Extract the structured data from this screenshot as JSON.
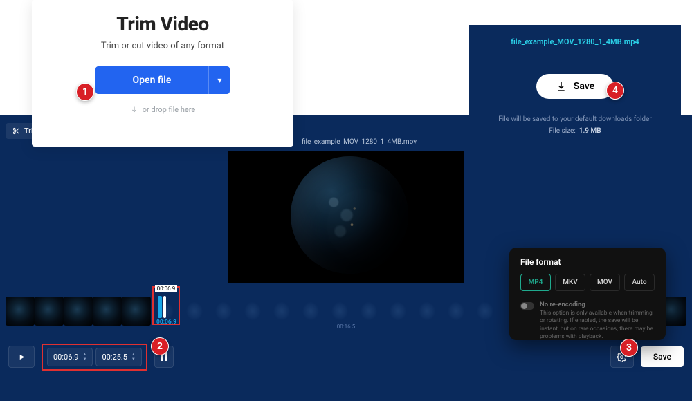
{
  "badges": {
    "one": "1",
    "two": "2",
    "three": "3",
    "four": "4"
  },
  "trimTab": {
    "label": "Trim"
  },
  "openPanel": {
    "title": "Trim Video",
    "subtitle": "Trim or cut video of any format",
    "openButton": "Open file",
    "dropHint": "or drop file here"
  },
  "filenameTop": "file_example_MOV_1280_1_4MB.mov",
  "savePanel": {
    "filename": "file_example_MOV_1280_1_4MB.mp4",
    "saveButton": "Save",
    "note": "File will be saved to your default downloads folder",
    "sizeLabel": "File size:",
    "sizeValue": "1.9 MB"
  },
  "formatCard": {
    "title": "File format",
    "mp4": "MP4",
    "mkv": "MKV",
    "mov": "MOV",
    "auto": "Auto",
    "reencTitle": "No re-encoding",
    "reencDesc": "This option is only available when trimming or rotating. If enabled, the save will be instant, but on rare occasions, there may be problems with playback."
  },
  "playhead": {
    "top": "00:06.9",
    "bottom": "00:06.9"
  },
  "timeMid": "00:16.5",
  "controls": {
    "start": "00:06.9",
    "end": "00:25.5",
    "save": "Save"
  }
}
